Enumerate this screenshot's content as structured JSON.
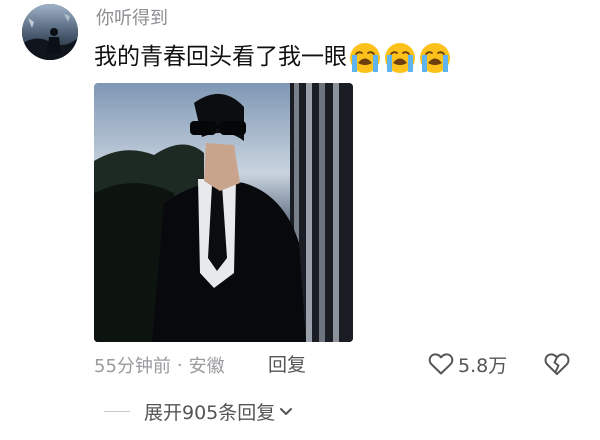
{
  "comment": {
    "username": "你听得到",
    "text": "我的青春回头看了我一眼",
    "emojis": [
      "crying-face",
      "crying-face",
      "crying-face"
    ],
    "photo_icon": "man-in-sunglasses-photo",
    "time": "55分钟前",
    "separator": "·",
    "location": "安徽",
    "reply_label": "回复",
    "like_count": "5.8万",
    "expand_label": "展开905条回复",
    "colors": {
      "meta_text": "#9a9a9f",
      "action_text": "#555555",
      "body_text": "#111111",
      "emoji_face": "#fcc21b"
    }
  }
}
